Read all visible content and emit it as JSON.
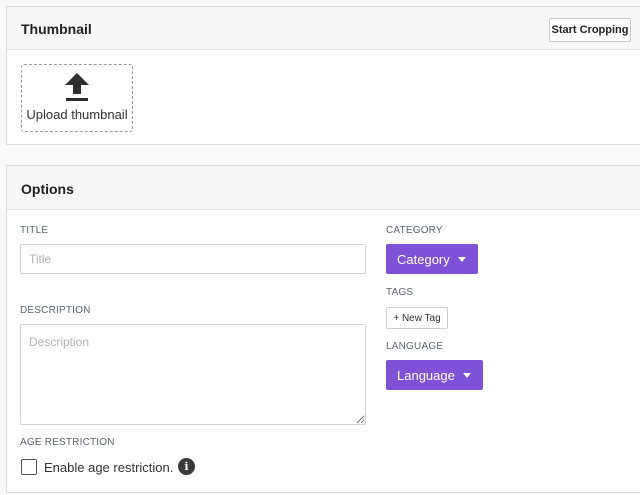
{
  "thumbnail": {
    "title": "Thumbnail",
    "crop_button_label": "Start Cropping",
    "upload_label": "Upload thumbnail",
    "upload_icon": "upload-arrow-icon"
  },
  "options": {
    "title": "Options",
    "title_field": {
      "label": "TITLE",
      "placeholder": "Title",
      "value": ""
    },
    "description_field": {
      "label": "DESCRIPTION",
      "placeholder": "Description",
      "value": ""
    },
    "category": {
      "label": "CATEGORY",
      "selected": "Category"
    },
    "tags": {
      "label": "TAGS",
      "new_tag_label": "+ New Tag"
    },
    "language": {
      "label": "LANGUAGE",
      "selected": "Language"
    },
    "age_restriction": {
      "label": "AGE RESTRICTION",
      "checkbox_label": "Enable age restriction.",
      "checked": false,
      "info_icon": "info-icon"
    }
  },
  "colors": {
    "accent": "#7d52d6",
    "panel_header_bg": "#f7f7f8",
    "border": "#dcdcdc"
  }
}
